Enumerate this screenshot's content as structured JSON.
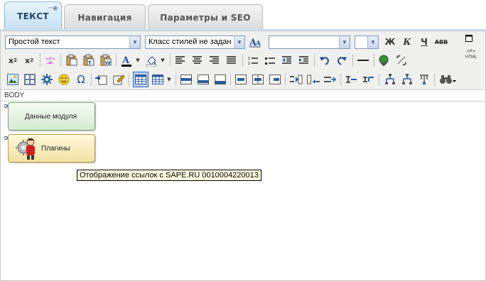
{
  "tabs": [
    {
      "label": "ТЕКСТ",
      "active": true
    },
    {
      "label": "Навигация",
      "active": false
    },
    {
      "label": "Параметры и SEO",
      "active": false
    }
  ],
  "toolbar": {
    "format_select": "Простой текст",
    "style_select": "Класс стилей не задан",
    "font_select": "",
    "size_select": "",
    "bold": "Ж",
    "italic": "К",
    "underline": "Ч",
    "strike": "ABB",
    "html_label": "<P>\nHTML"
  },
  "path_label": "BODY",
  "modules": [
    {
      "label": "Данные модуля"
    },
    {
      "label": "Плагины"
    }
  ],
  "tooltip": "Отображение ссылок с SAPE.RU 0010004220013",
  "colors": {
    "accent": "#316ac5",
    "tab_active": "#c7e1f5",
    "toolbar_bg": "#f0f0ee"
  }
}
